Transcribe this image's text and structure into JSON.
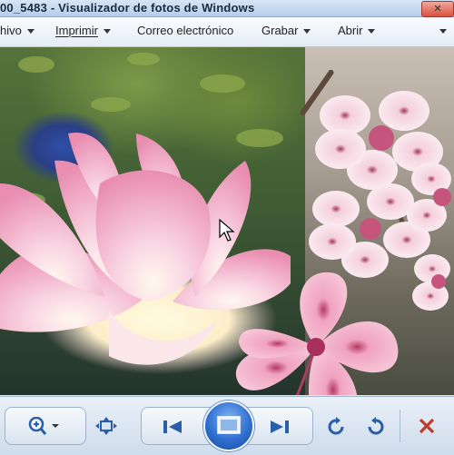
{
  "window": {
    "title": "00_5483 - Visualizador de fotos de Windows"
  },
  "menu": {
    "items": [
      {
        "label": "hivo"
      },
      {
        "label": "Imprimir"
      },
      {
        "label": "Correo electrónico"
      },
      {
        "label": "Grabar"
      },
      {
        "label": "Abrir"
      }
    ]
  },
  "toolbar": {
    "icons": [
      "zoom-icon",
      "fit-window-icon",
      "previous-icon",
      "slideshow-icon",
      "next-icon",
      "rotate-left-icon",
      "rotate-right-icon",
      "delete-icon"
    ]
  },
  "colors": {
    "accent": "#2f6fd0",
    "delete": "#c0392b",
    "lotus": "#f2a9c4"
  }
}
